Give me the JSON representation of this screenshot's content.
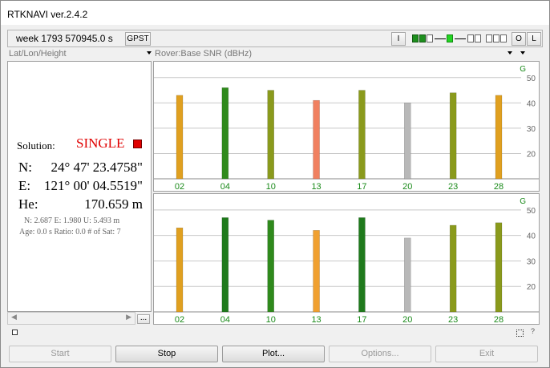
{
  "window": {
    "title": "RTKNAVI ver.2.4.2"
  },
  "toolbar": {
    "time": "week 1793 570945.0 s",
    "time_sys": "GPST",
    "btn_i": "I",
    "btn_o": "O",
    "btn_l": "L"
  },
  "left_view": {
    "mode": "Lat/Lon/Height"
  },
  "plot_view": {
    "mode": "Rover:Base SNR (dBHz)"
  },
  "solution": {
    "label": "Solution:",
    "status": "SINGLE",
    "status_color": "#e00000",
    "lat_label": "N:",
    "lat": "24° 47' 23.4758\"",
    "lon_label": "E:",
    "lon": "121° 00' 04.5519\"",
    "hgt_label": "He:",
    "hgt": "170.659 m",
    "std": "N: 2.687 E: 1.980 U: 5.493 m",
    "info": "Age: 0.0 s Ratio: 0.0 # of Sat: 7"
  },
  "chart_data": [
    {
      "type": "bar",
      "title": "",
      "system": "G",
      "categories": [
        "02",
        "04",
        "10",
        "13",
        "17",
        "20",
        "23",
        "28"
      ],
      "values": [
        43,
        46,
        45,
        41,
        45,
        40,
        44,
        43
      ],
      "colors": [
        "#e0a020",
        "#2f8a1c",
        "#8a9a1c",
        "#f08060",
        "#8a9a1c",
        "#b8b8b8",
        "#8a9a1c",
        "#e0a020"
      ],
      "y_ticks": [
        20,
        30,
        40,
        50
      ],
      "ylim": [
        10,
        55
      ],
      "grid": true
    },
    {
      "type": "bar",
      "title": "",
      "system": "G",
      "categories": [
        "02",
        "04",
        "10",
        "13",
        "17",
        "20",
        "23",
        "28"
      ],
      "values": [
        43,
        47,
        46,
        42,
        47,
        39,
        44,
        45
      ],
      "colors": [
        "#e0a020",
        "#1f7a1c",
        "#2f8a1c",
        "#f0a030",
        "#1f7a1c",
        "#b8b8b8",
        "#8a9a1c",
        "#8a9a1c"
      ],
      "y_ticks": [
        20,
        30,
        40,
        50
      ],
      "ylim": [
        10,
        55
      ],
      "grid": true
    }
  ],
  "status_bar": {
    "left_icon": "checkbox-icon",
    "right_icon": "help-icon"
  },
  "buttons": {
    "start": "Start",
    "stop": "Stop",
    "plot": "Plot...",
    "options": "Options...",
    "exit": "Exit"
  }
}
